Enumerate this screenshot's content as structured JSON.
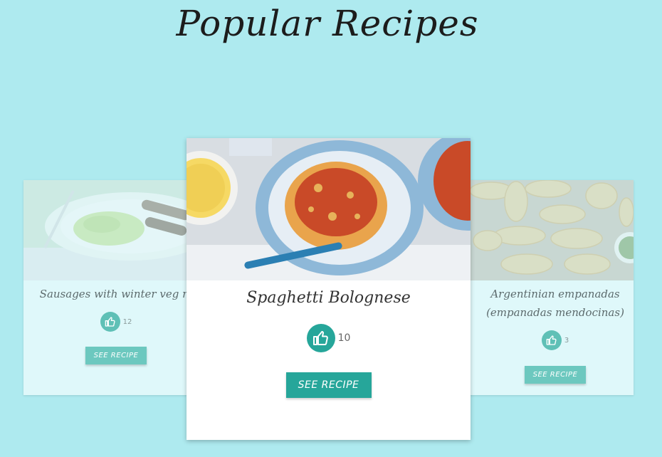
{
  "page": {
    "title": "Popular Recipes"
  },
  "cards": [
    {
      "title": "Sausages with winter veg m",
      "likes": "12",
      "button_label": "SEE RECIPE"
    },
    {
      "title": "Spaghetti Bolognese",
      "likes": "10",
      "button_label": "SEE RECIPE"
    },
    {
      "title_line1": "Argentinian empanadas",
      "title_line2": "(empanadas mendocinas)",
      "likes": "3",
      "button_label": "SEE RECIPE"
    }
  ],
  "icons": {
    "like": "thumbs-up-icon"
  },
  "colors": {
    "background": "#aeeaef",
    "accent": "#26a69a"
  }
}
